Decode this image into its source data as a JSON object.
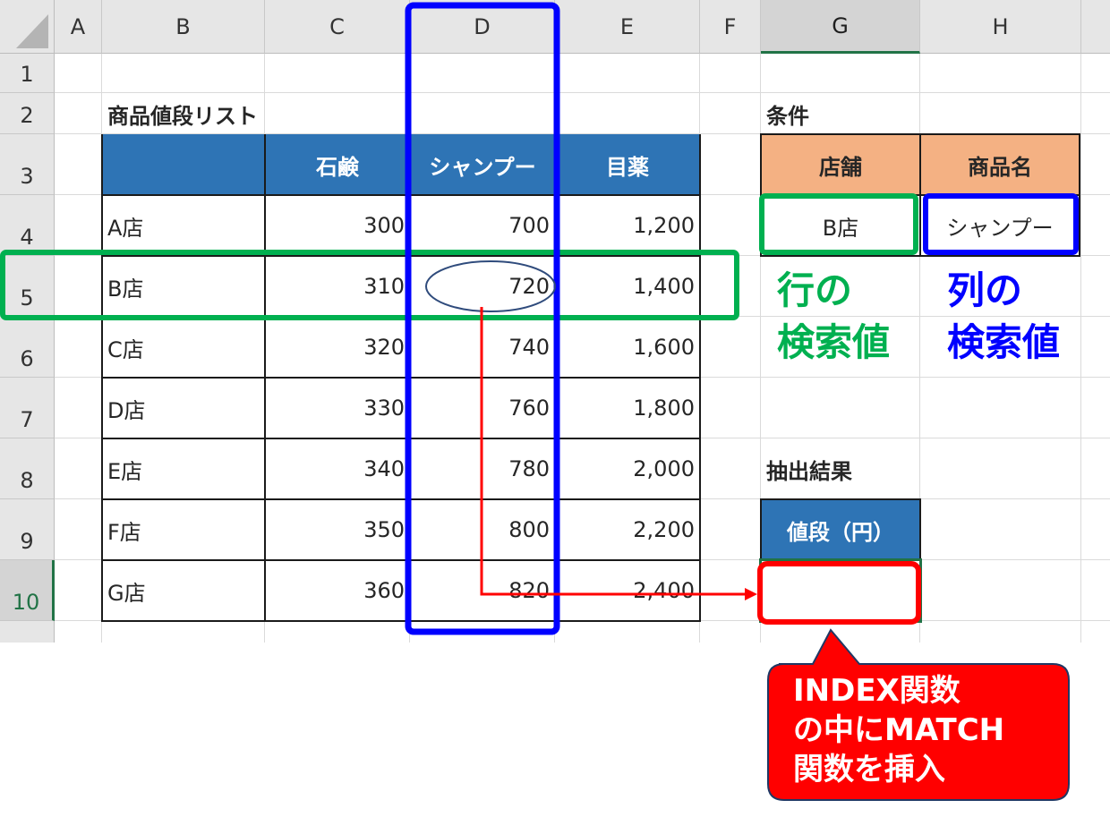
{
  "columns": [
    "A",
    "B",
    "C",
    "D",
    "E",
    "F",
    "G",
    "H"
  ],
  "rows": [
    "1",
    "2",
    "3",
    "4",
    "5",
    "6",
    "7",
    "8",
    "9",
    "10"
  ],
  "selected": {
    "column": "G",
    "row": "10"
  },
  "table": {
    "title": "商品値段リスト",
    "headers": [
      "",
      "石鹸",
      "シャンプー",
      "目薬"
    ],
    "rows": [
      [
        "A店",
        "300",
        "700",
        "1,200"
      ],
      [
        "B店",
        "310",
        "720",
        "1,400"
      ],
      [
        "C店",
        "320",
        "740",
        "1,600"
      ],
      [
        "D店",
        "330",
        "760",
        "1,800"
      ],
      [
        "E店",
        "340",
        "780",
        "2,000"
      ],
      [
        "F店",
        "350",
        "800",
        "2,200"
      ],
      [
        "G店",
        "360",
        "820",
        "2,400"
      ]
    ]
  },
  "conditions": {
    "title": "条件",
    "store_header": "店舗",
    "product_header": "商品名",
    "store_value": "B店",
    "product_value": "シャンプー"
  },
  "result": {
    "title": "抽出結果",
    "price_header": "値段（円）",
    "price_value": ""
  },
  "annotations": {
    "row_lookup_line1": "行の",
    "row_lookup_line2": "検索値",
    "col_lookup_line1": "列の",
    "col_lookup_line2": "検索値",
    "callout_line1": "INDEX関数",
    "callout_line2": "の中にMATCH",
    "callout_line3": "関数を挿入"
  },
  "colors": {
    "header_blue": "#2e74b5",
    "header_orange": "#f4b183",
    "highlight_green": "#00b050",
    "highlight_blue": "#0000ff",
    "highlight_red": "#ff0000",
    "excel_green": "#217346"
  }
}
